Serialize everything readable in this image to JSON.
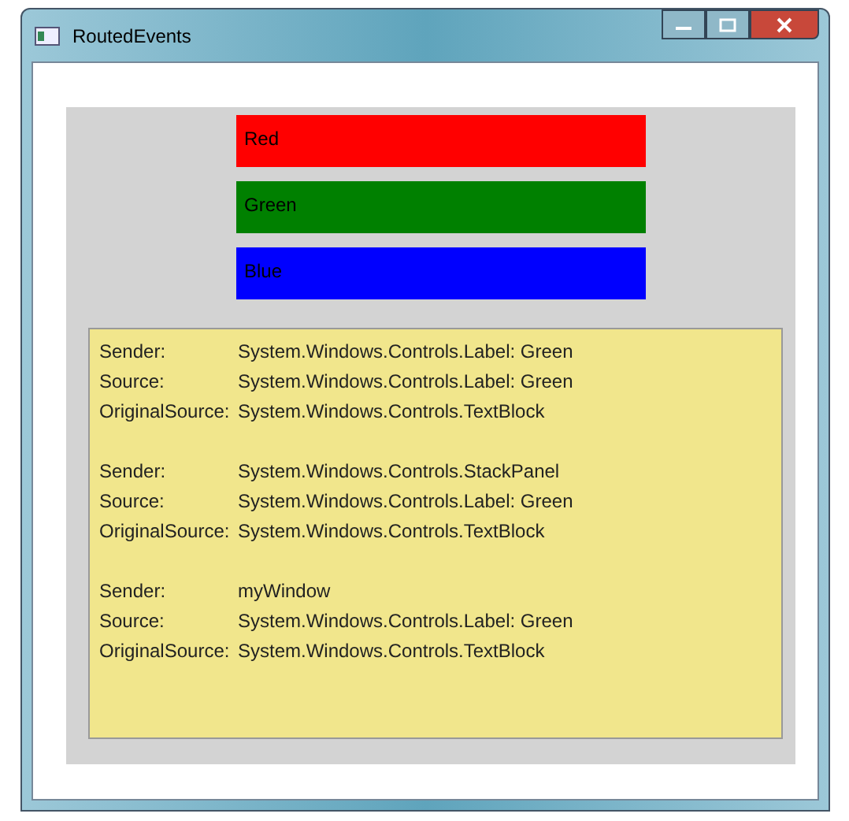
{
  "window": {
    "title": "RoutedEvents"
  },
  "labels": [
    {
      "text": "Red",
      "color": "#ff0000"
    },
    {
      "text": "Green",
      "color": "#008000"
    },
    {
      "text": "Blue",
      "color": "#0000ff"
    }
  ],
  "log": [
    {
      "lines": [
        {
          "label": "Sender:",
          "value": "System.Windows.Controls.Label: Green"
        },
        {
          "label": "Source:",
          "value": "System.Windows.Controls.Label: Green"
        },
        {
          "label": "OriginalSource:",
          "value": "System.Windows.Controls.TextBlock"
        }
      ]
    },
    {
      "lines": [
        {
          "label": "Sender:",
          "value": "System.Windows.Controls.StackPanel"
        },
        {
          "label": "Source:",
          "value": "System.Windows.Controls.Label: Green"
        },
        {
          "label": "OriginalSource:",
          "value": "System.Windows.Controls.TextBlock"
        }
      ]
    },
    {
      "lines": [
        {
          "label": "Sender:",
          "value": "myWindow"
        },
        {
          "label": "Source:",
          "value": "System.Windows.Controls.Label: Green"
        },
        {
          "label": "OriginalSource:",
          "value": "System.Windows.Controls.TextBlock"
        }
      ]
    }
  ]
}
